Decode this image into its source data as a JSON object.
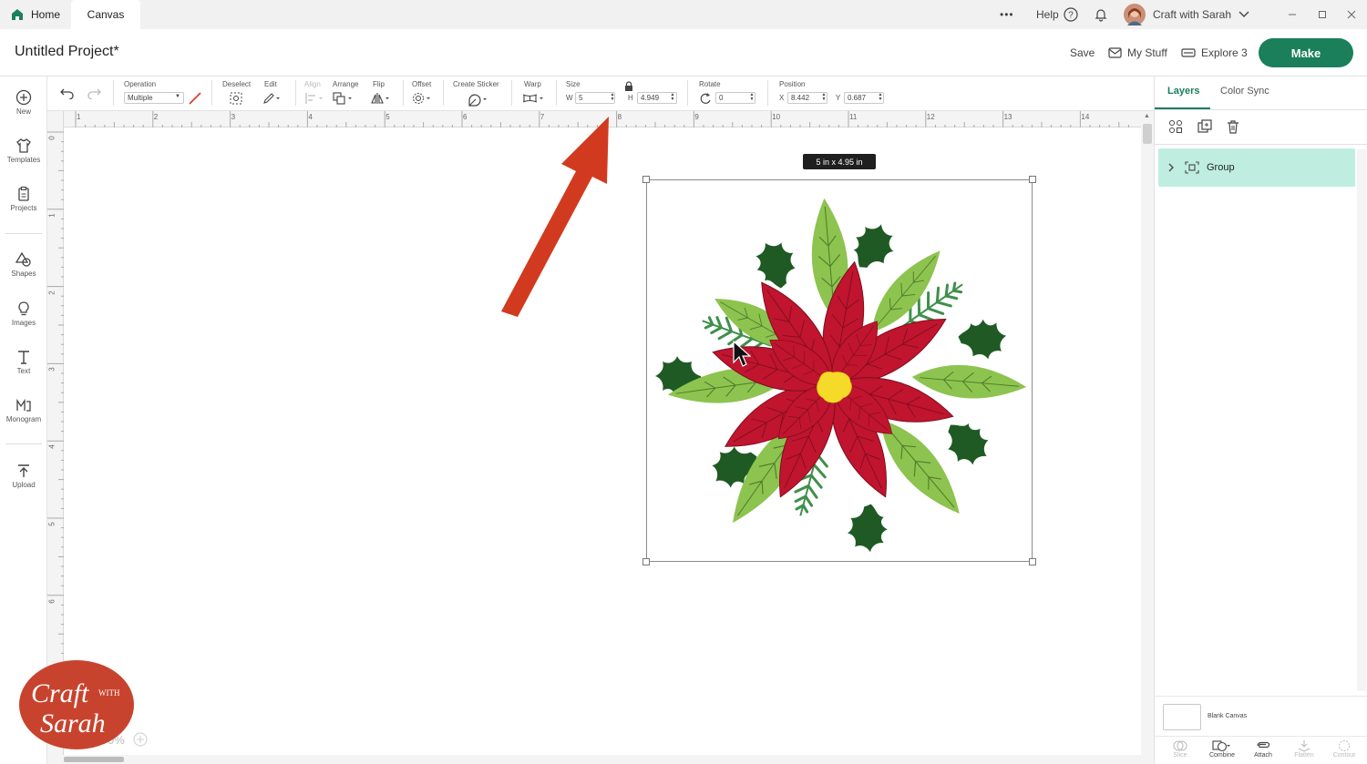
{
  "tabs": {
    "home": "Home",
    "canvas": "Canvas"
  },
  "topbar": {
    "more": "•••",
    "help": "Help",
    "user": "Craft with Sarah"
  },
  "header": {
    "title": "Untitled Project*",
    "save": "Save",
    "my_stuff": "My Stuff",
    "machine": "Explore 3",
    "make": "Make"
  },
  "leftbar": [
    {
      "label": "New",
      "icon": "plus-circle-icon"
    },
    {
      "label": "Templates",
      "icon": "shirt-icon"
    },
    {
      "label": "Projects",
      "icon": "clipboard-icon"
    },
    {
      "label": "Shapes",
      "icon": "shapes-icon"
    },
    {
      "label": "Images",
      "icon": "lightbulb-icon"
    },
    {
      "label": "Text",
      "icon": "text-icon"
    },
    {
      "label": "Monogram",
      "icon": "monogram-icon"
    },
    {
      "label": "Upload",
      "icon": "upload-icon"
    }
  ],
  "toolbar": {
    "operation_label": "Operation",
    "operation_value": "Multiple",
    "deselect": "Deselect",
    "edit": "Edit",
    "align": "Align",
    "arrange": "Arrange",
    "flip": "Flip",
    "offset": "Offset",
    "create_sticker": "Create Sticker",
    "warp": "Warp",
    "size": "Size",
    "w_label": "W",
    "w_value": "5",
    "h_label": "H",
    "h_value": "4.949",
    "rotate": "Rotate",
    "rotate_value": "0",
    "position": "Position",
    "x_label": "X",
    "x_value": "8.442",
    "y_label": "Y",
    "y_value": "0.687"
  },
  "ruler": {
    "top": [
      "1",
      "2",
      "3",
      "4",
      "5",
      "6",
      "7",
      "8",
      "9",
      "10",
      "11",
      "12",
      "13",
      "14"
    ],
    "left": [
      "0",
      "1",
      "2",
      "3",
      "4",
      "5",
      "6"
    ]
  },
  "canvas": {
    "size_tooltip": "5  in x 4.95  in",
    "zoom": "0%"
  },
  "rightpanel": {
    "tab_layers": "Layers",
    "tab_color_sync": "Color Sync",
    "layer_group": "Group",
    "blank_canvas": "Blank Canvas"
  },
  "bottom_tools": [
    "Slice",
    "Combine",
    "Attach",
    "Flatten",
    "Contour"
  ],
  "logo": {
    "line1": "Craft",
    "with": "WITH",
    "line2": "Sarah"
  },
  "colors": {
    "accent": "#1a7f5a",
    "layer_highlight": "#bfeee0",
    "arrow": "#d23a1f",
    "poinsettia_red": "#c0142f",
    "leaf_light": "#8dc34f",
    "leaf_dark": "#1f5a24"
  }
}
